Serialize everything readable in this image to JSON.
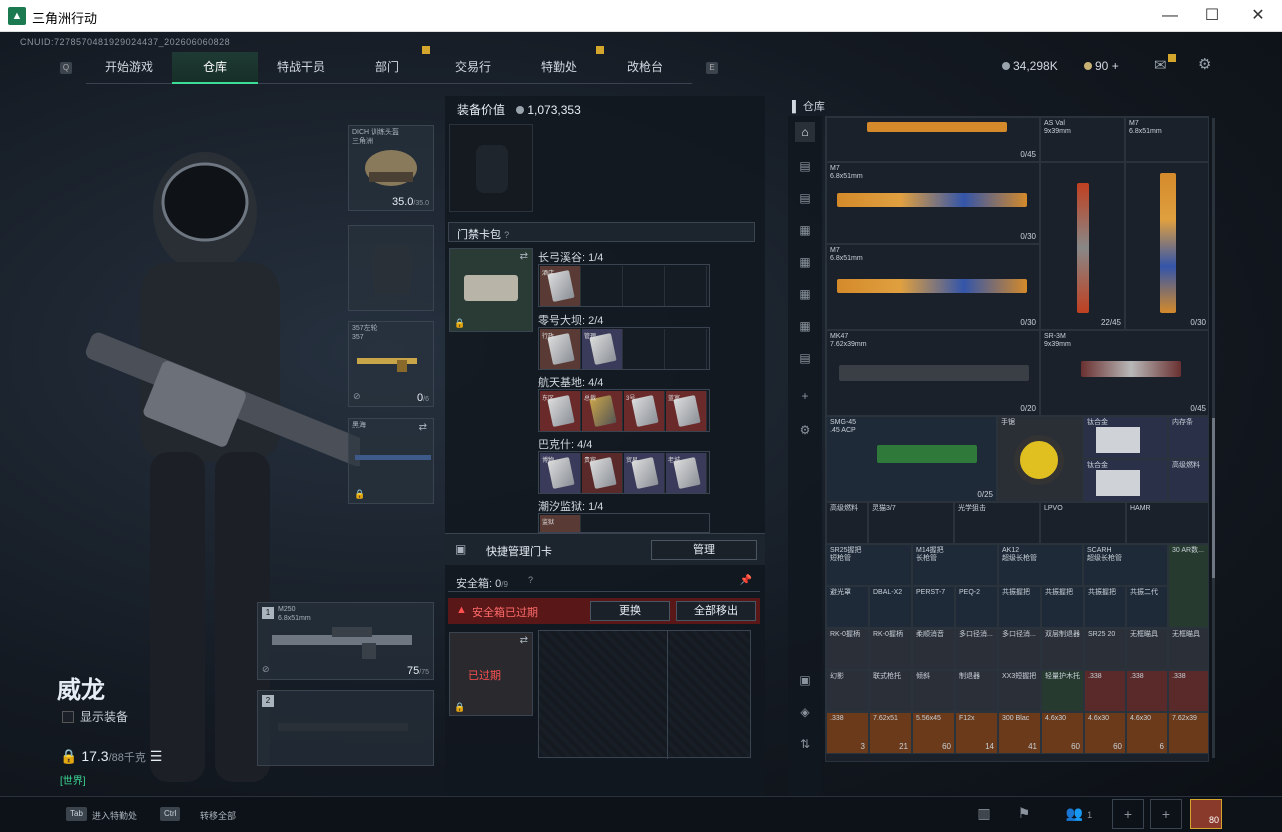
{
  "window": {
    "title": "三角洲行动",
    "minimize": "—",
    "maximize": "☐",
    "close": "✕"
  },
  "uid": "CNUID:7278570481929024437_202606060828",
  "nav": {
    "tabs": [
      "开始游戏",
      "仓库",
      "特战干员",
      "部门",
      "交易行",
      "特勤处",
      "改枪台"
    ],
    "active": 1,
    "key_left": "Q",
    "key_right": "E"
  },
  "currency": {
    "coins": "34,298K",
    "tickets": "90",
    "plus": "+"
  },
  "character": {
    "name": "威龙",
    "show_equip": "显示装备",
    "weight": "17.3",
    "weight_max": "/88千克",
    "channel": "[世界]"
  },
  "slots": {
    "helmet": {
      "label": "DICH 训练头盔\n三角洲",
      "value": "35.0",
      "max": "/35.0"
    },
    "pistol": {
      "label": "357左轮\n357",
      "value": "0",
      "max": "/6"
    },
    "melee": {
      "label": "黑海"
    },
    "primary1": {
      "index": "1",
      "label": "M250\n6.8x51mm",
      "value": "75",
      "max": "/75"
    },
    "primary2": {
      "index": "2"
    }
  },
  "middle": {
    "equip_value_label": "装备价值",
    "equip_value": "1,073,353",
    "keycard_title": "门禁卡包",
    "keycard_help": "?",
    "regions": [
      {
        "name": "长弓溪谷: 1/4",
        "cards": [
          "酒店"
        ]
      },
      {
        "name": "零号大坝: 2/4",
        "cards": [
          "行政",
          "管理"
        ]
      },
      {
        "name": "航天基地: 4/4",
        "cards": [
          "东区",
          "总裁",
          "3号",
          "蓝室"
        ]
      },
      {
        "name": "巴克什: 4/4",
        "cards": [
          "博物",
          "贵宾",
          "贸易",
          "老城"
        ]
      },
      {
        "name": "潮汐监狱: 1/4",
        "cards": [
          "监狱"
        ]
      }
    ],
    "quick_manage": "快捷管理门卡",
    "manage_button": "管理",
    "safebox_label": "安全箱: ",
    "safebox_count": "0",
    "safebox_max": "/9",
    "safebox_expired": "安全箱已过期",
    "swap_button": "更换",
    "move_all_button": "全部移出",
    "expired_tag": "已过期"
  },
  "warehouse": {
    "title": "仓库",
    "items": [
      {
        "name": "M7\n6.8x51mm",
        "count": "0/30"
      },
      {
        "name": "M7\n6.8x51mm",
        "count": "0/30"
      },
      {
        "name": "AS Val\n9x39mm",
        "count": "22/45"
      },
      {
        "name": "M7\n6.8x51mm",
        "count": "0/30"
      },
      {
        "name": "MK47\n7.62x39mm",
        "count": "0/20"
      },
      {
        "name": "SR-3M\n9x39mm",
        "count": "0/45"
      },
      {
        "name": "SMG-45\n.45 ACP",
        "count": "0/25"
      },
      {
        "name": "手锯",
        "count": ""
      },
      {
        "name": "钛合金",
        "count": ""
      },
      {
        "name": "内存条",
        "count": ""
      },
      {
        "name": "钛合金",
        "count": ""
      },
      {
        "name": "高级燃料",
        "count": ""
      },
      {
        "name": "0/45",
        "count": "0/45"
      },
      {
        "name": "AS Val top",
        "count": "0/45"
      }
    ],
    "attachments_row1": [
      "高级燃料",
      "灵猫3/7",
      "光学狙击",
      "LPVO",
      "HAMR"
    ],
    "attachments_row2": [
      "SR25握把\n短枪管",
      "M14握把\n长枪管",
      "AK12\n超级长枪管",
      "SCARH\n超级长枪管",
      "30 AR数..."
    ],
    "attachments_row3": [
      "避光罩",
      "DBAL-X2",
      "PERST-7",
      "PEQ-2",
      "共振握把",
      "共振握把",
      "共振握把",
      "共振二代"
    ],
    "attachments_row4": [
      "RK-0握柄",
      "RK-0握柄",
      "柔顺消音",
      "多口径消...",
      "多口径消...",
      "双层制退器",
      "SR25 20",
      "无框瞄具",
      "无框瞄具"
    ],
    "attachments_row5": [
      "幻影",
      "联式枪托",
      "倾斜",
      "制退器",
      "XX3短握把",
      "轻量护木托",
      ".338",
      ".338",
      ".338"
    ],
    "ammo_row": [
      ".338",
      "7.62x51",
      "5.56x45",
      "F12x",
      "300 Blac",
      "4.6x30",
      "4.6x30",
      "4.6x30",
      "7.62x39"
    ],
    "ammo_counts": [
      "3",
      "21",
      "60",
      "14",
      "41",
      "60",
      "60",
      "6",
      ""
    ]
  },
  "bottom": {
    "key1": "Tab",
    "text1": "进入特勤处",
    "key2": "Ctrl",
    "text2": "转移全部",
    "squad_count": "1",
    "level": "80"
  },
  "colors": {
    "accent": "#3ddc97",
    "warning": "#ff5050",
    "badge": "#d4a72c"
  }
}
